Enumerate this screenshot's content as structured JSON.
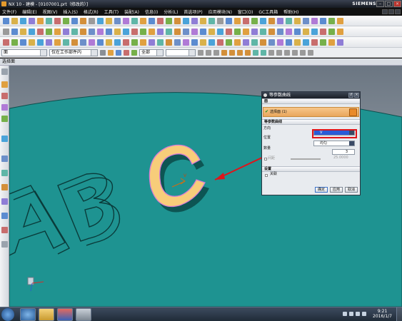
{
  "window": {
    "title": "NX 10 - 建模 - [0107001.prt（修改的）]",
    "brand": "SIEMENS"
  },
  "menu": [
    "文件(F)",
    "编辑(E)",
    "视图(V)",
    "插入(S)",
    "格式(R)",
    "工具(T)",
    "装配(A)",
    "信息(I)",
    "分析(L)",
    "首选项(P)",
    "应用模块(N)",
    "窗口(O)",
    "GC工具箱",
    "帮助(H)"
  ],
  "filterbar": {
    "selection_filter": "面",
    "scope": "仅在工作部件内",
    "snap": "全部"
  },
  "selection_bar": {
    "label": "选择面"
  },
  "dialog": {
    "title": "等参数曲线",
    "face_section": "面",
    "select_face": "选择面 (1)",
    "params_section": "等参数曲线",
    "direction_label": "方向",
    "direction_value": "V",
    "position_label": "位置",
    "position_value": "均匀",
    "count_label": "数量",
    "count_value": "3",
    "spacing_label": "间距",
    "spacing_value": "25.0000",
    "settings_section": "设置",
    "associative_label": "关联",
    "ok": "确定",
    "apply": "应用",
    "cancel": "取消"
  },
  "viewport": {
    "text_3d": "ABC",
    "axis_label": "V",
    "background": "#1e9391",
    "letter_face": "#f7cd7a"
  },
  "taskbar": {
    "time": "9:21",
    "date": "2016/1/7"
  },
  "colors": {
    "accent_red": "#e0141a",
    "selection_orange": "#f0b06a",
    "dialog_title": "#2a313c"
  }
}
